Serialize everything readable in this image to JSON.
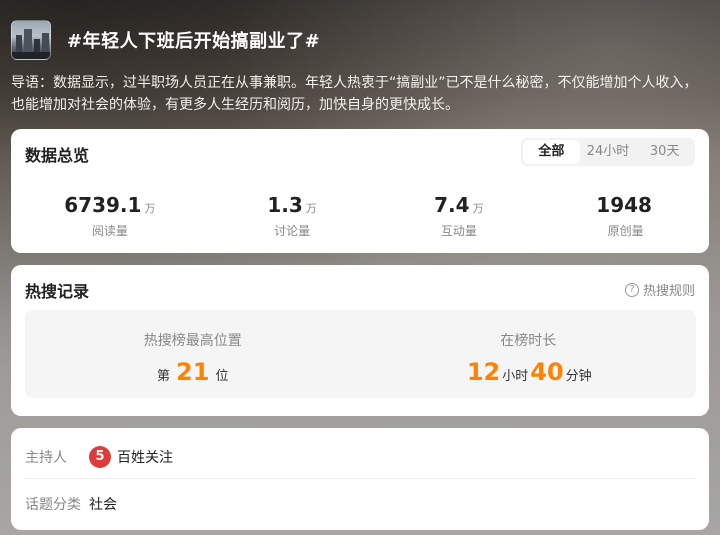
{
  "header": {
    "title": "#年轻人下班后开始搞副业了#",
    "intro": "导语：数据显示，过半职场人员正在从事兼职。年轻人热衷于“搞副业”已不是什么秘密，不仅能增加个人收入，也能增加对社会的体验，有更多人生经历和阅历，加快自身的更快成长。"
  },
  "overview": {
    "title": "数据总览",
    "tabs": [
      "全部",
      "24小时",
      "30天"
    ],
    "active_tab": "全部",
    "stats": [
      {
        "value": "6739.1",
        "unit": "万",
        "label": "阅读量"
      },
      {
        "value": "1.3",
        "unit": "万",
        "label": "讨论量"
      },
      {
        "value": "7.4",
        "unit": "万",
        "label": "互动量"
      },
      {
        "value": "1948",
        "unit": "",
        "label": "原创量"
      }
    ]
  },
  "hot": {
    "title": "热搜记录",
    "rules_label": "热搜规则",
    "peak": {
      "label": "热搜榜最高位置",
      "prefix": "第",
      "value": "21",
      "suffix": "位"
    },
    "duration": {
      "label": "在榜时长",
      "hours": "12",
      "hours_unit": "小时",
      "minutes": "40",
      "minutes_unit": "分钟"
    }
  },
  "info": {
    "host_label": "主持人",
    "host_name": "百姓关注",
    "category_label": "话题分类",
    "category_value": "社会"
  },
  "colors": {
    "accent": "#ff8200",
    "host_icon": "#e03b3b"
  }
}
